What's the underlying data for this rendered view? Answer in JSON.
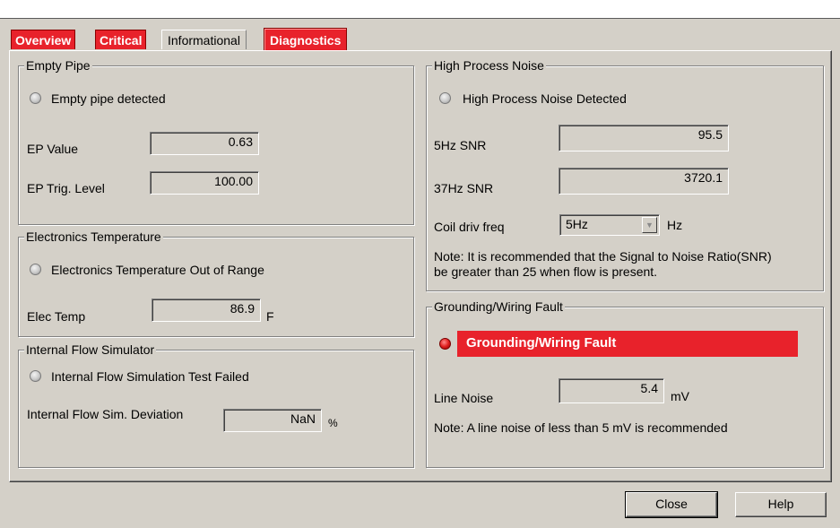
{
  "tabs": [
    {
      "label": "Overview",
      "style": "red"
    },
    {
      "label": "Critical",
      "style": "red"
    },
    {
      "label": "Informational",
      "style": "plain"
    },
    {
      "label": "Diagnostics",
      "style": "active"
    }
  ],
  "empty_pipe": {
    "title": "Empty Pipe",
    "status_label": "Empty pipe detected",
    "ep_value_label": "EP Value",
    "ep_value": "0.63",
    "ep_trig_label": "EP Trig. Level",
    "ep_trig_value": "100.00"
  },
  "electronics_temperature": {
    "title": "Electronics Temperature",
    "status_label": "Electronics Temperature Out of Range",
    "elec_temp_label": "Elec Temp",
    "elec_temp_value": "86.9",
    "unit": "F"
  },
  "internal_flow_simulator": {
    "title": "Internal Flow Simulator",
    "status_label": "Internal Flow Simulation Test Failed",
    "deviation_label": "Internal Flow Sim. Deviation",
    "deviation_value": "NaN",
    "unit": "%"
  },
  "high_process_noise": {
    "title": "High Process Noise",
    "status_label": "High Process Noise Detected",
    "snr5_label": "5Hz SNR",
    "snr5_value": "95.5",
    "snr37_label": "37Hz SNR",
    "snr37_value": "3720.1",
    "coil_freq_label": "Coil driv freq",
    "coil_freq_value": "5Hz",
    "coil_freq_unit": "Hz",
    "note_line1": "Note: It is recommended that the Signal to Noise Ratio(SNR)",
    "note_line2": "be greater than 25 when flow is present."
  },
  "grounding_wiring_fault": {
    "title": "Grounding/Wiring Fault",
    "alert_label": "Grounding/Wiring Fault",
    "line_noise_label": "Line Noise",
    "line_noise_value": "5.4",
    "unit": "mV",
    "note": "Note: A line noise of less than 5 mV is recommended"
  },
  "buttons": {
    "close": "Close",
    "help": "Help"
  },
  "colors": {
    "alert_red": "#e8222b",
    "dialog_gray": "#d4d0c8"
  }
}
